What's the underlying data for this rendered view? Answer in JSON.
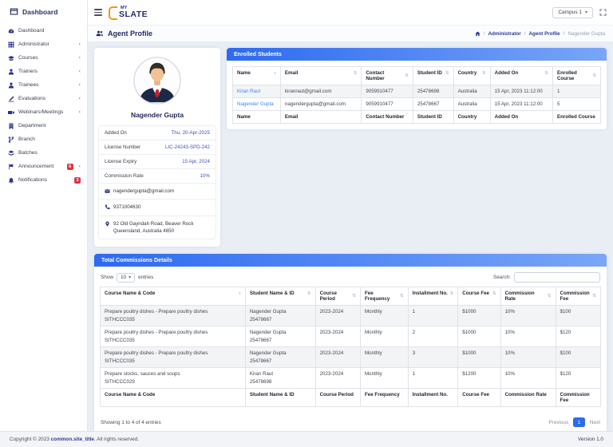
{
  "topbar": {
    "logo_my": "MY",
    "logo_slate": "SLATE",
    "campus": "Campus 1"
  },
  "sidebar": {
    "brand": "Dashboard",
    "items": [
      {
        "label": "Dashboard"
      },
      {
        "label": "Administrator"
      },
      {
        "label": "Courses"
      },
      {
        "label": "Trainers"
      },
      {
        "label": "Trainees"
      },
      {
        "label": "Evaluations"
      },
      {
        "label": "Webinars/Meetings"
      },
      {
        "label": "Department"
      },
      {
        "label": "Branch"
      },
      {
        "label": "Batches"
      },
      {
        "label": "Announcement",
        "badge": "6"
      },
      {
        "label": "Notifications",
        "badge": "3"
      }
    ]
  },
  "page": {
    "title": "Agent Profile",
    "breadcrumb_1": "Administrator",
    "breadcrumb_2": "Agent Profile",
    "breadcrumb_3": "Nagender Gupta"
  },
  "profile": {
    "name": "Nagender Gupta",
    "fields": [
      {
        "label": "Added On",
        "value": "Thu, 20-Apr-2025"
      },
      {
        "label": "License Number",
        "value": "LIC-24243-SPD-242"
      },
      {
        "label": "License Expiry",
        "value": "15 Apr, 2024"
      },
      {
        "label": "Commission Rate",
        "value": "10%"
      }
    ],
    "email": "nagendergupta@gmail.com",
    "phone": "9371004630",
    "address": "92 Old Gayndah Road, Beaver Rock Queensland, Australia 4650"
  },
  "enrolled": {
    "title": "Enrolled Students",
    "columns": [
      "Name",
      "Email",
      "Contact Number",
      "Student ID",
      "Country",
      "Added On",
      "Enrolled Course"
    ],
    "rows": [
      {
        "name": "Kiran Raut",
        "email": "kiranraut@gmail.com",
        "contact": "9059910477",
        "student_id": "25478698",
        "country": "Australia",
        "added_on": "15 Apr, 2023 11:12:00",
        "enrolled_course": "1"
      },
      {
        "name": "Nagender Gupta",
        "email": "nagendergupta@gmail.com",
        "contact": "9059910477",
        "student_id": "25478667",
        "country": "Australia",
        "added_on": "15 Apr, 2023 11:12:00",
        "enrolled_course": "5"
      }
    ]
  },
  "commissions": {
    "title": "Total Commissions Details",
    "show_label": "Show",
    "page_length": "10",
    "entries_label": "entries",
    "search_label": "Search:",
    "columns": [
      "Course Name & Code",
      "Student Name & ID",
      "Course Period",
      "Fee Frequency",
      "Installment No.",
      "Course Fee",
      "Commission Rate",
      "Commission Fee"
    ],
    "rows": [
      {
        "course": "Prepare poultry dishes - Prepare poultry dishes",
        "code": "SITHCCC035",
        "student": "Nagender Gupta",
        "student_id": "25478667",
        "period": "2023-2024",
        "frequency": "Monthly",
        "installment": "1",
        "course_fee": "$1000",
        "rate": "10%",
        "commission_fee": "$100"
      },
      {
        "course": "Prepare poultry dishes - Prepare poultry dishes",
        "code": "SITHCCC035",
        "student": "Nagender Gupta",
        "student_id": "25478667",
        "period": "2023-2024",
        "frequency": "Monthly",
        "installment": "2",
        "course_fee": "$1000",
        "rate": "10%",
        "commission_fee": "$120"
      },
      {
        "course": "Prepare poultry dishes - Prepare poultry dishes",
        "code": "SITHCCC035",
        "student": "Nagender Gupta",
        "student_id": "25478667",
        "period": "2023-2024",
        "frequency": "Monthly",
        "installment": "3",
        "course_fee": "$1000",
        "rate": "10%",
        "commission_fee": "$100"
      },
      {
        "course": "Prepare stocks, sauces and soups",
        "code": "SITHCCC029",
        "student": "Kiran Raut",
        "student_id": "25478698",
        "period": "2023-2024",
        "frequency": "Monthly",
        "installment": "1",
        "course_fee": "$1200",
        "rate": "10%",
        "commission_fee": "$120"
      }
    ],
    "summary": "Showing 1 to 4 of 4 entries",
    "pagination": {
      "previous": "Previous",
      "page": "1",
      "next": "Next"
    }
  },
  "footer": {
    "copyright_prefix": "Copyright © 2023",
    "site_title": "common.site_title",
    "copyright_suffix": ". All rights reserved.",
    "version": "Version 1.0"
  },
  "icons": {
    "sort": "⇅",
    "sort_asc": "↑",
    "chevron_collapse": "‹",
    "select_caret": "▾"
  },
  "colors": {
    "accent_blue": "#2d6af0",
    "header_gradient_end": "#79a6f8",
    "navy": "#232d6b",
    "sidebar_icon_indigo": "#2e3192",
    "link_blue": "#4285f4",
    "value_blue": "#3d53c5",
    "badge_red": "#e03444",
    "logo_orange": "#f7941d",
    "background": "#e9edf4"
  }
}
